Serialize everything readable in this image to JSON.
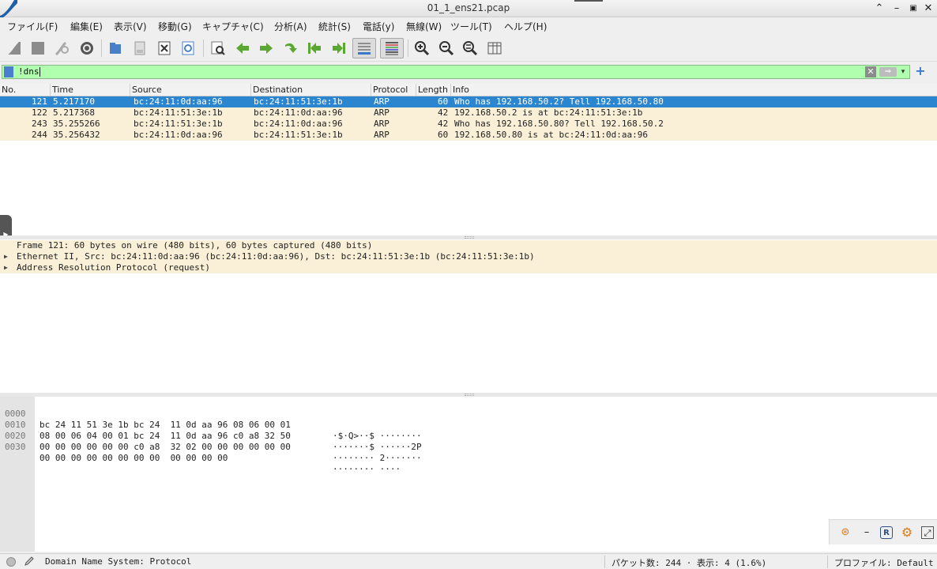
{
  "window": {
    "title": "01_1_ens21.pcap"
  },
  "menu": [
    {
      "label": "ファイル(F)"
    },
    {
      "label": "編集(E)"
    },
    {
      "label": "表示(V)"
    },
    {
      "label": "移動(G)"
    },
    {
      "label": "キャプチャ(C)"
    },
    {
      "label": "分析(A)"
    },
    {
      "label": "統計(S)"
    },
    {
      "label": "電話(y)"
    },
    {
      "label": "無線(W)"
    },
    {
      "label": "ツール(T)"
    },
    {
      "label": "ヘルプ(H)"
    }
  ],
  "toolbar": {
    "icons": [
      "shark-start-icon",
      "stop-icon",
      "restart-icon",
      "options-gear-icon",
      "open-file-icon",
      "save-file-icon",
      "close-file-icon",
      "reload-icon",
      "find-packet-icon",
      "go-back-icon",
      "go-forward-icon",
      "go-to-packet-icon",
      "first-packet-icon",
      "last-packet-icon",
      "autoscroll-icon",
      "colorize-icon",
      "zoom-in-icon",
      "zoom-out-icon",
      "zoom-normal-icon",
      "resize-columns-icon"
    ]
  },
  "filter": {
    "value": "!dns",
    "color": "#afffaf"
  },
  "packet_list": {
    "columns": [
      "No.",
      "Time",
      "Source",
      "Destination",
      "Protocol",
      "Length",
      "Info"
    ],
    "rows": [
      {
        "no": "121",
        "time": "5.217170",
        "src": "bc:24:11:0d:aa:96",
        "dst": "bc:24:11:51:3e:1b",
        "proto": "ARP",
        "len": "60",
        "info": "Who has 192.168.50.2? Tell 192.168.50.80"
      },
      {
        "no": "122",
        "time": "5.217368",
        "src": "bc:24:11:51:3e:1b",
        "dst": "bc:24:11:0d:aa:96",
        "proto": "ARP",
        "len": "42",
        "info": "192.168.50.2 is at bc:24:11:51:3e:1b"
      },
      {
        "no": "243",
        "time": "35.255266",
        "src": "bc:24:11:51:3e:1b",
        "dst": "bc:24:11:0d:aa:96",
        "proto": "ARP",
        "len": "42",
        "info": "Who has 192.168.50.80? Tell 192.168.50.2"
      },
      {
        "no": "244",
        "time": "35.256432",
        "src": "bc:24:11:0d:aa:96",
        "dst": "bc:24:11:51:3e:1b",
        "proto": "ARP",
        "len": "60",
        "info": "192.168.50.80 is at bc:24:11:0d:aa:96"
      }
    ],
    "selected_color": "#2b86cf",
    "arp_color": "#faf0d7"
  },
  "details": [
    {
      "expandable": false,
      "text": "Frame 121: 60 bytes on wire (480 bits), 60 bytes captured (480 bits)"
    },
    {
      "expandable": true,
      "text": "Ethernet II, Src: bc:24:11:0d:aa:96 (bc:24:11:0d:aa:96), Dst: bc:24:11:51:3e:1b (bc:24:11:51:3e:1b)"
    },
    {
      "expandable": true,
      "text": "Address Resolution Protocol (request)"
    }
  ],
  "bytes": [
    {
      "offset": "0000",
      "hex": "bc 24 11 51 3e 1b bc 24  11 0d aa 96 08 06 00 01",
      "ascii": "·$·Q>··$ ········"
    },
    {
      "offset": "0010",
      "hex": "08 00 06 04 00 01 bc 24  11 0d aa 96 c0 a8 32 50",
      "ascii": "·······$ ······2P"
    },
    {
      "offset": "0020",
      "hex": "00 00 00 00 00 00 c0 a8  32 02 00 00 00 00 00 00",
      "ascii": "········ 2·······"
    },
    {
      "offset": "0030",
      "hex": "00 00 00 00 00 00 00 00  00 00 00 00",
      "ascii": "········ ····"
    }
  ],
  "status": {
    "field_info": "Domain Name System: Protocol",
    "packets": "パケット数: 244 · 表示: 4 (1.6%)",
    "profile": "プロファイル: Default"
  }
}
